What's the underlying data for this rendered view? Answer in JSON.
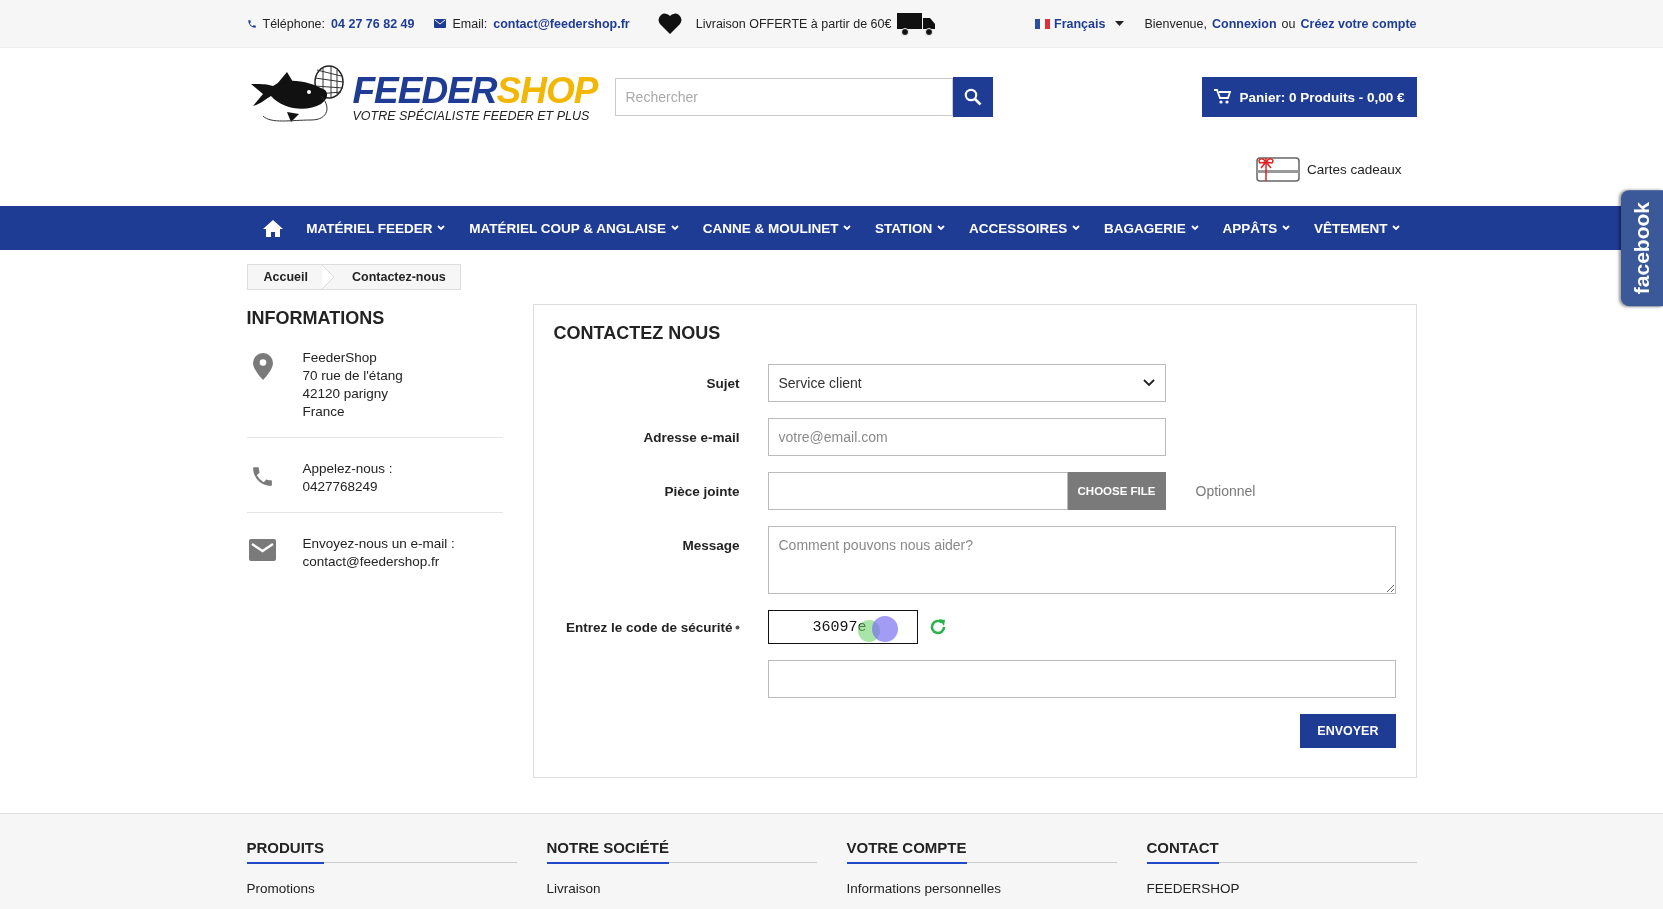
{
  "top_bar": {
    "phone_label": "Téléphone:",
    "phone": "04 27 76 82 49",
    "email_label": "Email:",
    "email": "contact@feedershop.fr",
    "delivery": "Livraison OFFERTE à partir de 60€",
    "language": "Français",
    "welcome": "Bienvenue,",
    "login": "Connexion",
    "or": "ou",
    "register": "Créez votre compte"
  },
  "header": {
    "logo_part_1": "FEEDER",
    "logo_part_2": "SHOP",
    "logo_tagline": "VOTRE SPÉCIALISTE FEEDER ET PLUS",
    "search": {
      "placeholder": "Rechercher"
    },
    "cart": "Panier: 0 Produits - 0,00 €",
    "gift_cards": "Cartes cadeaux"
  },
  "nav": {
    "items": [
      {
        "label": "MATÉRIEL FEEDER"
      },
      {
        "label": "MATÉRIEL COUP & ANGLAISE"
      },
      {
        "label": "CANNE & MOULINET"
      },
      {
        "label": "STATION"
      },
      {
        "label": "ACCESSOIRES"
      },
      {
        "label": "BAGAGERIE"
      },
      {
        "label": "APPÂTS"
      },
      {
        "label": "VÊTEMENT"
      }
    ]
  },
  "breadcrumb": [
    "Accueil",
    "Contactez-nous"
  ],
  "informations": {
    "title": "INFORMATIONS",
    "blocks": [
      {
        "kind": "address",
        "lines": [
          "FeederShop",
          "70 rue de l'étang",
          "42120 parigny",
          "France"
        ]
      },
      {
        "kind": "phone",
        "lines": [
          "Appelez-nous :",
          "0427768249"
        ]
      },
      {
        "kind": "email",
        "lines": [
          "Envoyez-nous un e-mail :",
          "contact@feedershop.fr"
        ]
      }
    ]
  },
  "contact_form": {
    "title": "CONTACTEZ NOUS",
    "fields": [
      {
        "kind": "select",
        "label": "Sujet",
        "value": "Service client",
        "required": false
      },
      {
        "kind": "text",
        "label": "Adresse e-mail",
        "placeholder": "votre@email.com",
        "required": false
      },
      {
        "kind": "file",
        "label": "Pièce jointe",
        "button": "CHOOSE FILE",
        "note": "Optionnel",
        "required": false
      },
      {
        "kind": "textarea",
        "label": "Message",
        "placeholder": "Comment pouvons nous aider?",
        "required": false
      },
      {
        "kind": "captcha",
        "label": "Entrez le code de sécurité",
        "code": "36097e",
        "required": true
      },
      {
        "kind": "captcha_input",
        "required": false
      }
    ],
    "submit": "ENVOYER"
  },
  "footer": {
    "columns": [
      {
        "title": "PRODUITS",
        "links": [
          "Promotions"
        ]
      },
      {
        "title": "NOTRE SOCIÉTÉ",
        "links": [
          "Livraison"
        ]
      },
      {
        "title": "VOTRE COMPTE",
        "links": [
          "Informations personnelles"
        ]
      },
      {
        "title": "CONTACT",
        "links": [
          "FEEDERSHOP"
        ]
      }
    ]
  },
  "facebook_tab": "facebook"
}
